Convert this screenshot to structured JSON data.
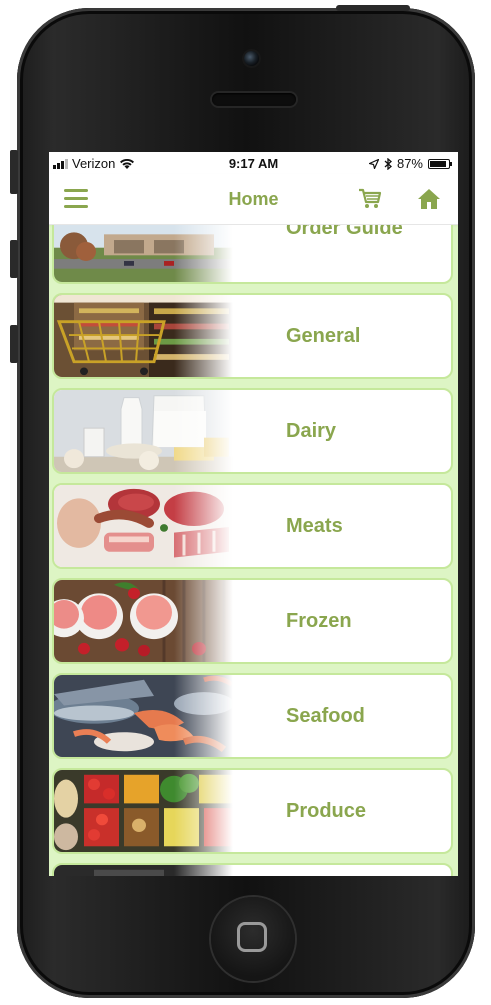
{
  "status_bar": {
    "carrier": "Verizon",
    "time": "9:17 AM",
    "battery_text": "87%",
    "battery_level": 0.87
  },
  "nav": {
    "title": "Home",
    "icons": [
      "menu-icon",
      "cart-icon",
      "home-icon"
    ]
  },
  "categories": [
    {
      "label": "Order Guide",
      "image": "building-photo"
    },
    {
      "label": "General",
      "image": "shopping-cart-aisle-photo"
    },
    {
      "label": "Dairy",
      "image": "milk-cheese-eggs-photo"
    },
    {
      "label": "Meats",
      "image": "raw-meats-photo"
    },
    {
      "label": "Frozen",
      "image": "ice-cream-strawberries-photo"
    },
    {
      "label": "Seafood",
      "image": "fish-shrimp-photo"
    },
    {
      "label": "Produce",
      "image": "vegetables-photo"
    },
    {
      "label": "",
      "image": "partial-next-photo"
    }
  ],
  "colors": {
    "accent": "#8aa64e",
    "list_background": "#ddf5c4",
    "card_border": "#c5e89b"
  }
}
